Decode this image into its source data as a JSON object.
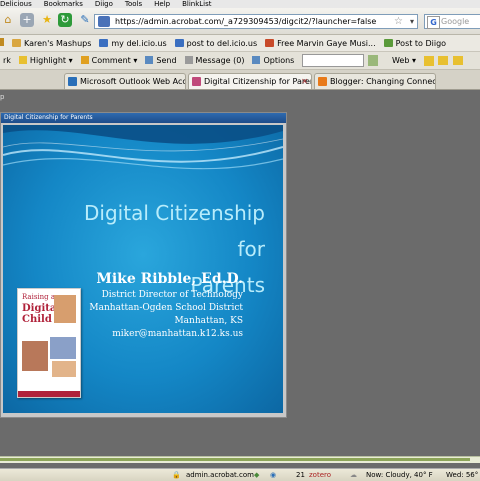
{
  "menubar": {
    "items": [
      "Delicious",
      "Bookmarks",
      "Diigo",
      "Tools",
      "Help",
      "BlinkList"
    ]
  },
  "navbar": {
    "url": "https://admin.acrobat.com/_a729309453/digcit2/?launcher=false",
    "search_placeholder": "Google"
  },
  "bookmarks": [
    {
      "label": "Karen's Mashups",
      "color": "#d9a640"
    },
    {
      "label": "my del.icio.us",
      "color": "#3b6fc0"
    },
    {
      "label": "post to del.icio.us",
      "color": "#3b6fc0"
    },
    {
      "label": "Free Marvin Gaye Musi...",
      "color": "#c84a2a"
    },
    {
      "label": "Post to Diigo",
      "color": "#5a9a3a"
    }
  ],
  "toolbar": {
    "items": [
      "rk",
      "Highlight",
      "Comment",
      "Send",
      "Message (0)",
      "Options"
    ],
    "web_label": "Web"
  },
  "tabs": [
    {
      "label": "Microsoft Outlook Web Access",
      "favicon_color": "#2a6fb8",
      "active": false
    },
    {
      "label": "Digital Citizenship for Parents",
      "favicon_color": "#c04a7a",
      "active": true
    },
    {
      "label": "Blogger: Changing Connections - ...",
      "favicon_color": "#e87a1a",
      "active": false
    }
  ],
  "strip_label": "p",
  "slide": {
    "window_title": "Digital Citizenship for Parents",
    "heading_line1": "Digital Citizenship for",
    "heading_line2": "Parents",
    "presenter_name": "Mike Ribble, Ed.D.",
    "lines": [
      "District Director of Technology",
      "Manhattan-Ogden School District",
      "Manhattan, KS",
      "miker@manhattan.k12.ks.us"
    ],
    "book_title_small": "Raising a",
    "book_title_big": "Digital Child"
  },
  "status": {
    "host": "admin.acrobat.com",
    "temp_count": "21",
    "zotero_label": "zotero",
    "weather": "Now: Cloudy, 40° F",
    "forecast": "Wed: 56°"
  }
}
